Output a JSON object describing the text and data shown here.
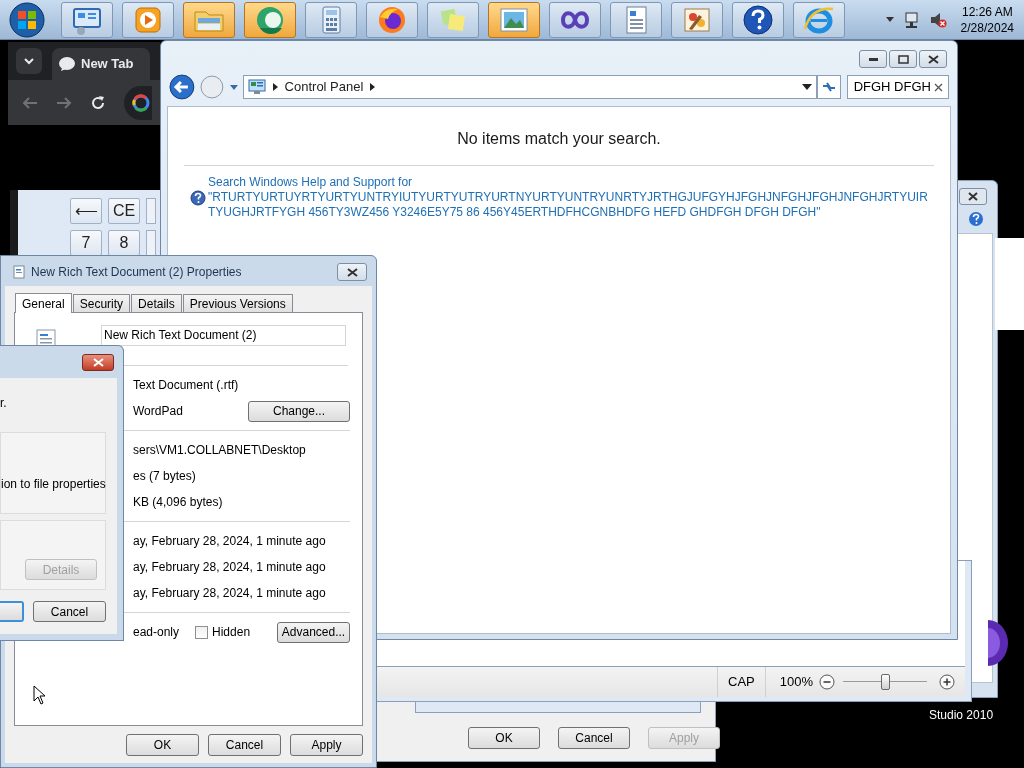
{
  "taskbar": {
    "buttons": [
      {
        "highlighted": false
      },
      {
        "highlighted": false
      },
      {
        "highlighted": true
      },
      {
        "highlighted": true
      },
      {
        "highlighted": false
      },
      {
        "highlighted": false
      },
      {
        "highlighted": false
      },
      {
        "highlighted": true
      },
      {
        "highlighted": false
      },
      {
        "highlighted": false
      },
      {
        "highlighted": false
      },
      {
        "highlighted": false
      },
      {
        "highlighted": false
      }
    ],
    "clock_time": "12:26 AM",
    "clock_date": "2/28/2024"
  },
  "browser": {
    "tab": "New Tab"
  },
  "calculator": {
    "keys": [
      "⟵",
      "CE",
      "7",
      "8"
    ]
  },
  "control_panel": {
    "breadcrumb": "Control Panel",
    "search_value": "DFGH DFGH",
    "message": "No items match your search.",
    "help_link": "Search Windows Help and Support for",
    "help_query": "\"RTURTYURTUYRTYURTYUNTRYIUTYURTYUTRYURTNYURTYUNTRYUNRTYJRTHGJUFGYHJFGHJNFGHJFGHJNFGHJRTYUIRTYUGHJRTFYGH 456TY3WZ456 Y3246E5Y75 86 456Y45ERTHDFHCGNBHDFG HEFD GHDFGH DFGH DFGH\""
  },
  "wordpad_status": {
    "caps": "CAP",
    "zoom": "100%",
    "zoom_slider": {
      "level": 0.5
    }
  },
  "back_dialog": {
    "buttons": [
      {
        "label": "OK",
        "disabled": false
      },
      {
        "label": "Cancel",
        "disabled": false
      },
      {
        "label": "Apply",
        "disabled": true
      }
    ]
  },
  "desktop_icon_label": "Studio 2010",
  "properties": {
    "title": "New Rich Text Document (2) Properties",
    "tabs": [
      {
        "label": "General",
        "selected": true
      },
      {
        "label": "Security",
        "selected": false
      },
      {
        "label": "Details",
        "selected": false
      },
      {
        "label": "Previous Versions",
        "selected": false
      }
    ],
    "file_name": "New Rich Text Document (2)",
    "sections": [
      {
        "rows": [
          {
            "value": "Text Document (.rtf)"
          },
          {
            "value": "WordPad",
            "button": "Change..."
          }
        ]
      },
      {
        "rows": [
          {
            "value": "sers\\VM1.COLLABNET\\Desktop"
          },
          {
            "value": "es (7 bytes)"
          },
          {
            "value": "KB (4,096 bytes)"
          }
        ]
      },
      {
        "rows": [
          {
            "value": "ay, February 28, 2024, 1 minute ago"
          },
          {
            "value": "ay, February 28, 2024, 1 minute ago"
          },
          {
            "value": "ay, February 28, 2024, 1 minute ago"
          }
        ]
      }
    ],
    "attributes": [
      {
        "kind": "text",
        "label": "ead-only"
      },
      {
        "kind": "checkbox",
        "label": "Hidden",
        "checked": false
      }
    ],
    "advanced": "Advanced...",
    "buttons": [
      {
        "label": "OK",
        "disabled": false
      },
      {
        "label": "Cancel",
        "disabled": false
      },
      {
        "label": "Apply",
        "disabled": false
      }
    ]
  },
  "front_dialog": {
    "texts": [
      "r.",
      "ion to file properties"
    ],
    "details_button": {
      "label": "Details",
      "disabled": true
    },
    "cancel": "Cancel"
  }
}
